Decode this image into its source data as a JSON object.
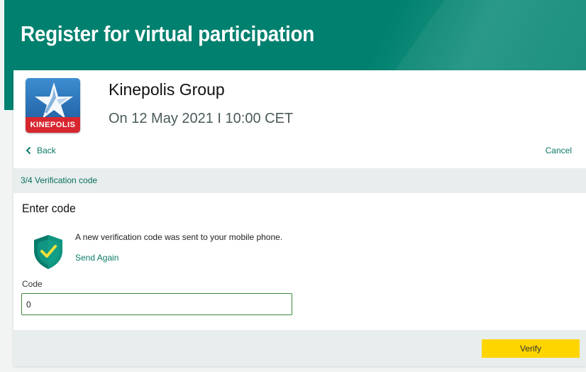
{
  "header": {
    "title": "Register for virtual participation"
  },
  "company": {
    "name": "Kinepolis Group",
    "event_date": "On 12 May 2021 I 10:00 CET",
    "logo_text": "KINEPOLIS"
  },
  "nav": {
    "back_label": "Back",
    "cancel_label": "Cancel"
  },
  "step": {
    "label": "3/4 Verification code"
  },
  "form": {
    "heading": "Enter code",
    "message": "A new verification code was sent to your mobile phone.",
    "send_again_label": "Send Again",
    "code_label": "Code",
    "code_value": "0",
    "verify_label": "Verify"
  },
  "colors": {
    "brand_green": "#00806e",
    "link_green": "#0c7a68",
    "verify_yellow": "#ffd500",
    "logo_red": "#d8262f",
    "logo_blue": "#2a6fb3"
  },
  "icons": {
    "back": "chevron-left-icon",
    "shield": "shield-check-icon"
  }
}
